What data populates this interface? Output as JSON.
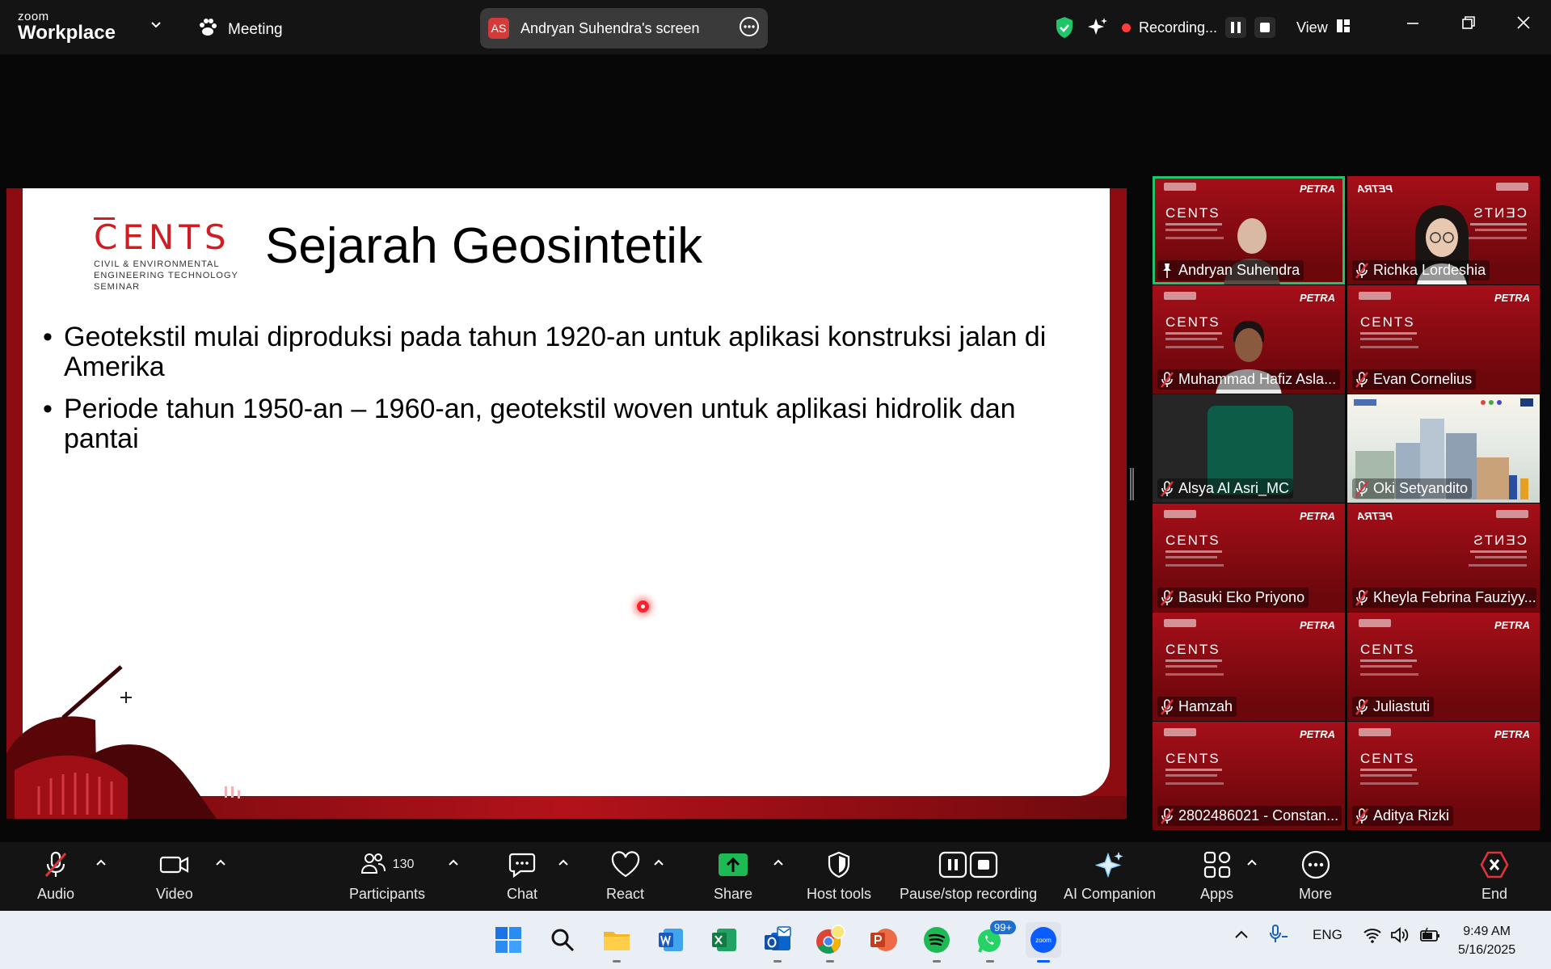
{
  "app": {
    "brand_small": "zoom",
    "brand_name": "Workplace",
    "meeting_label": "Meeting"
  },
  "share": {
    "initials": "AS",
    "label": "Andryan Suhendra's screen"
  },
  "status": {
    "recording_label": "Recording...",
    "view_label": "View"
  },
  "slide": {
    "logo_text": "CENTS",
    "logo_sub": [
      "CIVIL & ENVIRONMENTAL",
      "ENGINEERING TECHNOLOGY",
      "SEMINAR"
    ],
    "title": "Sejarah Geosintetik",
    "bullets": [
      "Geotekstil mulai diproduksi pada tahun 1920-an untuk aplikasi konstruksi jalan di Amerika",
      "Periode tahun 1950-an – 1960-an, geotekstil woven untuk aplikasi hidrolik dan pantai"
    ]
  },
  "participants": [
    {
      "name": "Andryan Suhendra",
      "active": true,
      "pinned": true,
      "style": "red",
      "brand": "PETRA",
      "video": "man-bald"
    },
    {
      "name": "Richka Lordeshia",
      "style": "red",
      "brand": "PETRA",
      "video": "woman-glasses",
      "mirrored": true
    },
    {
      "name": "Muhammad Hafiz Asla...",
      "style": "red",
      "brand": "PETRA",
      "video": "man-young"
    },
    {
      "name": "Evan Cornelius",
      "style": "red",
      "brand": "PETRA"
    },
    {
      "name": "Alsya Al Asri_MC",
      "style": "blank"
    },
    {
      "name": "Oki Setyandito",
      "style": "building"
    },
    {
      "name": "Basuki Eko Priyono",
      "style": "red",
      "brand": "PETRA"
    },
    {
      "name": "Kheyla Febrina Fauziyy...",
      "style": "red",
      "brand": "PETRA",
      "mirrored": true
    },
    {
      "name": "Hamzah",
      "style": "red",
      "brand": "PETRA"
    },
    {
      "name": "Juliastuti",
      "style": "red",
      "brand": "PETRA"
    },
    {
      "name": "2802486021 - Constan...",
      "style": "red",
      "brand": "PETRA"
    },
    {
      "name": "Aditya Rizki",
      "style": "red",
      "brand": "PETRA"
    }
  ],
  "toolbar": {
    "audio": "Audio",
    "video": "Video",
    "participants": "Participants",
    "participants_count": "130",
    "chat": "Chat",
    "react": "React",
    "share": "Share",
    "host_tools": "Host tools",
    "recording": "Pause/stop recording",
    "ai_companion": "AI Companion",
    "apps": "Apps",
    "more": "More",
    "end": "End"
  },
  "taskbar": {
    "whatsapp_badge": "99+",
    "lang": "ENG",
    "time": "9:49 AM",
    "date": "5/16/2025"
  },
  "colors": {
    "accent_green": "#22c46a",
    "end_red": "#e0323c",
    "slide_red": "#d01c22",
    "share_green": "#1db954"
  }
}
